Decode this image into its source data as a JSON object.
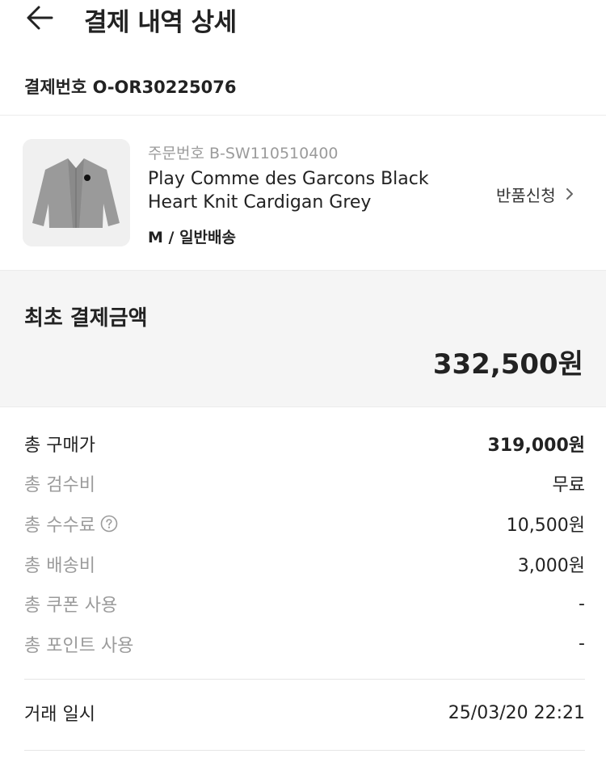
{
  "header": {
    "title": "결제 내역 상세",
    "back_icon": "arrow-left-icon"
  },
  "payment": {
    "payment_number": "결제번호 O-OR30225076"
  },
  "product": {
    "order_number": "주문번호 B-SW110510400",
    "name": "Play Comme des Garcons Black Heart Knit Cardigan Grey",
    "option": "M / 일반배송",
    "image_icon": "grey-cardigan-thumbnail",
    "return_label": "반품신청",
    "return_icon": "chevron-right-icon"
  },
  "initial_payment": {
    "label": "최초 결제금액",
    "amount": "332,500원"
  },
  "breakdown": [
    {
      "label": "총 구매가",
      "value": "319,000원"
    },
    {
      "label": "총 검수비",
      "value": "무료"
    },
    {
      "label": "총 수수료",
      "value": "10,500원",
      "icon": "question-circle-icon"
    },
    {
      "label": "총 배송비",
      "value": "3,000원"
    },
    {
      "label": "총 쿠폰 사용",
      "value": "-"
    },
    {
      "label": "총 포인트 사용",
      "value": "-"
    }
  ],
  "transaction": {
    "label": "거래 일시",
    "value": "25/03/20 22:21"
  },
  "colors": {
    "text": "#222222",
    "muted": "#9b9b9b",
    "panel": "#f5f5f5",
    "divider": "#ececec"
  }
}
